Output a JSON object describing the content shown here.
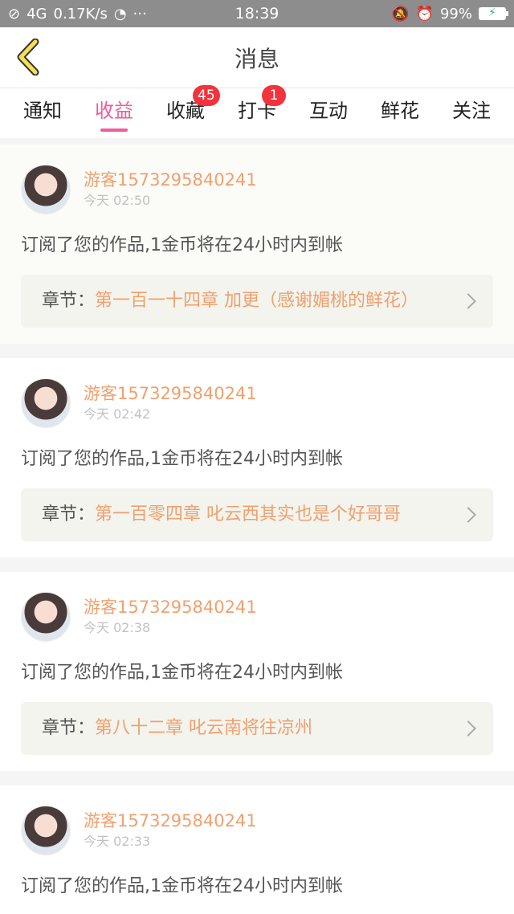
{
  "status_bar": {
    "speed": "0.17K/s",
    "network": "4G",
    "time": "18:39",
    "battery": "99%"
  },
  "header": {
    "title": "消息"
  },
  "tabs": [
    {
      "label": "通知",
      "badge": null,
      "active": false
    },
    {
      "label": "收益",
      "badge": null,
      "active": true
    },
    {
      "label": "收藏",
      "badge": "45",
      "active": false
    },
    {
      "label": "打卡",
      "badge": "1",
      "active": false
    },
    {
      "label": "互动",
      "badge": null,
      "active": false
    },
    {
      "label": "鲜花",
      "badge": null,
      "active": false
    },
    {
      "label": "关注",
      "badge": null,
      "active": false
    }
  ],
  "messages": [
    {
      "user": "游客1573295840241",
      "time": "今天 02:50",
      "text": "订阅了您的作品,1金币将在24小时内到帐",
      "chapter_label": "章节：",
      "chapter_title": "第一百一十四章 加更（感谢媚桃的鲜花）"
    },
    {
      "user": "游客1573295840241",
      "time": "今天 02:42",
      "text": "订阅了您的作品,1金币将在24小时内到帐",
      "chapter_label": "章节：",
      "chapter_title": "第一百零四章 叱云西其实也是个好哥哥"
    },
    {
      "user": "游客1573295840241",
      "time": "今天 02:38",
      "text": "订阅了您的作品,1金币将在24小时内到帐",
      "chapter_label": "章节：",
      "chapter_title": "第八十二章 叱云南将往凉州"
    },
    {
      "user": "游客1573295840241",
      "time": "今天 02:33",
      "text": "订阅了您的作品,1金币将在24小时内到帐",
      "chapter_label": "",
      "chapter_title": ""
    }
  ],
  "colors": {
    "accent": "#ee5d9a",
    "username": "#f0a06e",
    "badge": "#f2333d"
  },
  "icons": {
    "back": "back-chevron-icon"
  }
}
